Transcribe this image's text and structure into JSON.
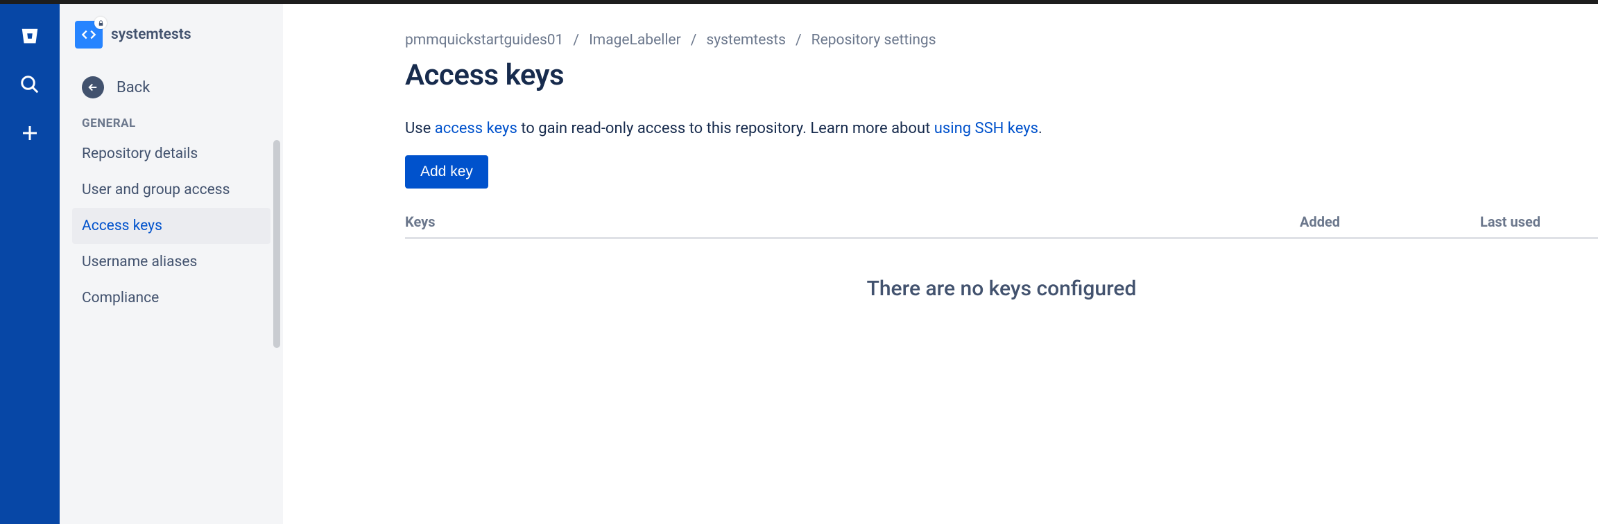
{
  "sidebar": {
    "repo_name": "systemtests",
    "back_label": "Back",
    "section_label": "GENERAL",
    "items": [
      {
        "label": "Repository details",
        "active": false
      },
      {
        "label": "User and group access",
        "active": false
      },
      {
        "label": "Access keys",
        "active": true
      },
      {
        "label": "Username aliases",
        "active": false
      },
      {
        "label": "Compliance",
        "active": false
      }
    ]
  },
  "breadcrumb": {
    "items": [
      "pmmquickstartguides01",
      "ImageLabeller",
      "systemtests",
      "Repository settings"
    ]
  },
  "page": {
    "title": "Access keys",
    "desc_prefix": "Use ",
    "desc_link1": "access keys",
    "desc_mid": " to gain read-only access to this repository. Learn more about ",
    "desc_link2": "using SSH keys",
    "desc_suffix": ".",
    "add_button": "Add key",
    "columns": {
      "keys": "Keys",
      "added": "Added",
      "last_used": "Last used"
    },
    "empty_state": "There are no keys configured"
  }
}
